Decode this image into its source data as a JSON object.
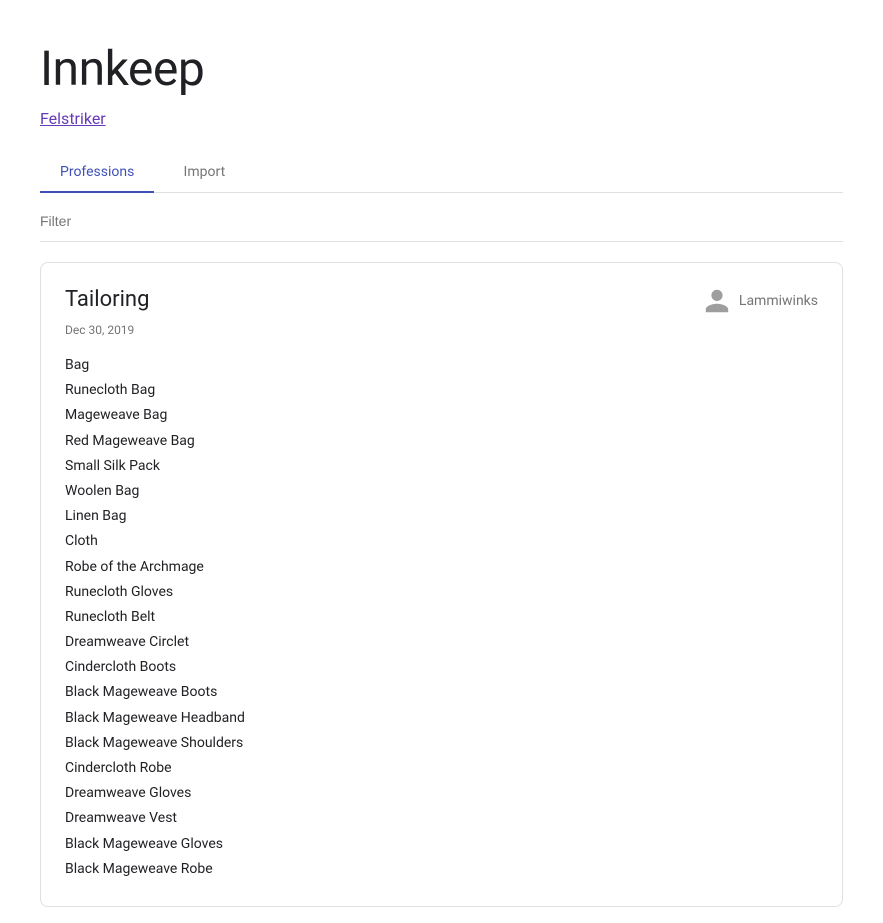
{
  "app": {
    "title": "Innkeep"
  },
  "realm": {
    "label": "Felstriker"
  },
  "tabs": [
    {
      "id": "professions",
      "label": "Professions",
      "active": true
    },
    {
      "id": "import",
      "label": "Import",
      "active": false
    }
  ],
  "filter": {
    "placeholder": "Filter",
    "value": ""
  },
  "card": {
    "title": "Tailoring",
    "date": "Dec 30, 2019",
    "user": "Lammiwinks",
    "items": [
      "Bag",
      "Runecloth Bag",
      "Mageweave Bag",
      "Red Mageweave Bag",
      "Small Silk Pack",
      "Woolen Bag",
      "Linen Bag",
      "Cloth",
      "Robe of the Archmage",
      "Runecloth Gloves",
      "Runecloth Belt",
      "Dreamweave Circlet",
      "Cindercloth Boots",
      "Black Mageweave Boots",
      "Black Mageweave Headband",
      "Black Mageweave Shoulders",
      "Cindercloth Robe",
      "Dreamweave Gloves",
      "Dreamweave Vest",
      "Black Mageweave Gloves",
      "Black Mageweave Robe"
    ]
  }
}
